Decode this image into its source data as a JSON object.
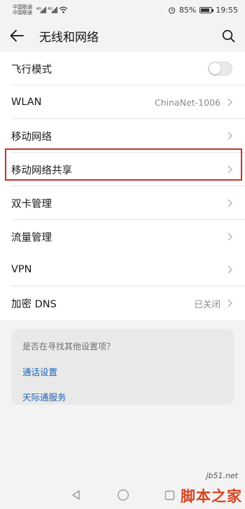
{
  "status_bar": {
    "carrier_1": "中国联通",
    "carrier_2": "中国联通",
    "network_1": "4G",
    "network_2": "4G",
    "battery": "85%",
    "battery_level": 0.85,
    "time": "19:55"
  },
  "header": {
    "title": "无线和网络",
    "back_icon": "arrow-left-icon",
    "search_icon": "search-icon"
  },
  "section_1": [
    {
      "label": "飞行模式",
      "type": "toggle",
      "on": false
    },
    {
      "label": "WLAN",
      "value": "ChinaNet-1006",
      "type": "chevron"
    },
    {
      "label": "移动网络",
      "type": "chevron"
    },
    {
      "label": "移动网络共享",
      "type": "chevron",
      "highlighted": true
    },
    {
      "label": "双卡管理",
      "type": "chevron"
    },
    {
      "label": "流量管理",
      "type": "chevron"
    }
  ],
  "section_2": [
    {
      "label": "VPN",
      "type": "chevron"
    },
    {
      "label": "加密 DNS",
      "value": "已关闭",
      "type": "chevron"
    }
  ],
  "suggestions": {
    "prompt": "是否在寻找其他设置项？",
    "links": [
      "通话设置",
      "天际通服务"
    ]
  },
  "nav_bar": {
    "icons": [
      "back-triangle-icon",
      "home-circle-icon",
      "recents-square-icon"
    ]
  },
  "watermark": {
    "url": "jb51.net",
    "text": "脚本之家"
  },
  "colors": {
    "highlight": "#c9302c",
    "link": "#1e63b5",
    "background": "#f3f3f3"
  }
}
